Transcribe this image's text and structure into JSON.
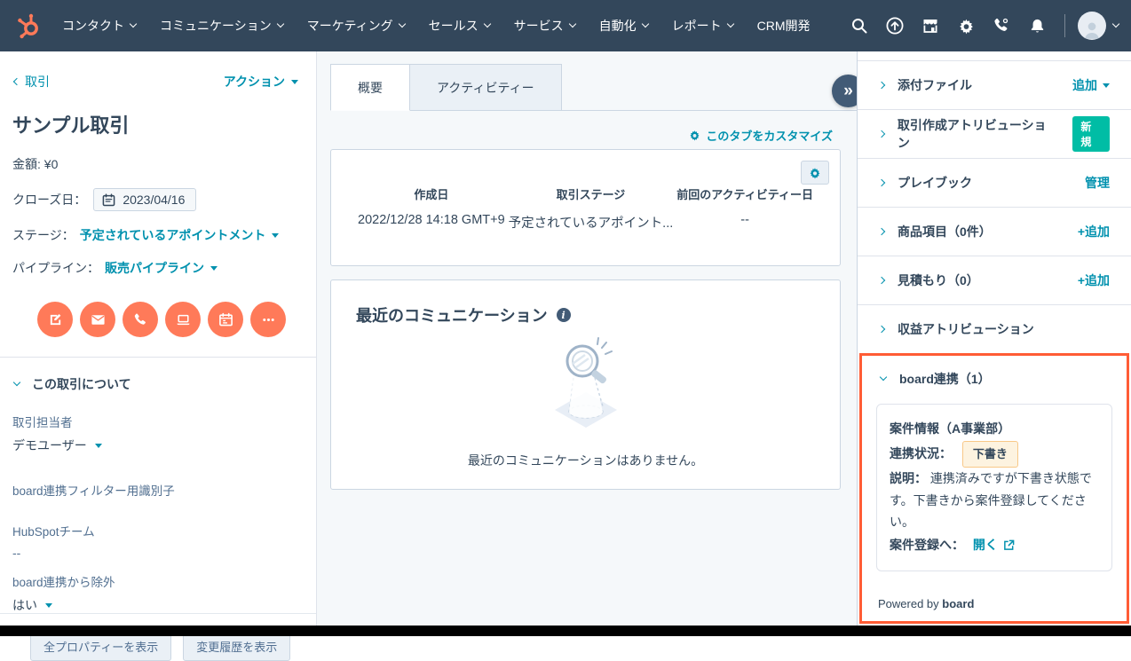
{
  "colors": {
    "navbar_bg": "#33475b",
    "accent_orange": "#ff7a59",
    "link_teal": "#0091ae",
    "text_navy": "#33475b",
    "highlight_border": "#ff5c35",
    "new_badge_bg": "#00bda5",
    "status_badge_bg": "#fdf3e0",
    "status_badge_border": "#f8c888"
  },
  "navbar": {
    "menu": [
      {
        "label": "コンタクト"
      },
      {
        "label": "コミュニケーション"
      },
      {
        "label": "マーケティング"
      },
      {
        "label": "セールス"
      },
      {
        "label": "サービス"
      },
      {
        "label": "自動化"
      },
      {
        "label": "レポート"
      },
      {
        "label": "CRM開発"
      }
    ],
    "icons": [
      "search",
      "upload",
      "marketplace",
      "settings",
      "call",
      "notifications",
      "account"
    ]
  },
  "left_panel": {
    "back_label": "取引",
    "actions_label": "アクション",
    "title": "サンプル取引",
    "amount": "金額: ¥0",
    "close_date_label": "クローズ日：",
    "close_date_value": "2023/04/16",
    "stage_label": "ステージ：",
    "stage_value": "予定されているアポイントメント",
    "pipeline_label": "パイプライン：",
    "pipeline_value": "販売パイプライン",
    "action_icons": [
      "note",
      "email",
      "call",
      "task",
      "meeting",
      "more"
    ],
    "about_title": "この取引について",
    "fields": [
      {
        "label": "取引担当者",
        "value": "デモユーザー"
      },
      {
        "label": "board連携フィルター用識別子",
        "value": ""
      },
      {
        "label": "HubSpotチーム",
        "value": "--"
      },
      {
        "label": "board連携から除外",
        "value": "はい"
      }
    ],
    "show_all_properties": "全プロパティーを表示",
    "show_history": "変更履歴を表示"
  },
  "center": {
    "tabs": [
      {
        "label": "概要"
      },
      {
        "label": "アクティビティー"
      }
    ],
    "active_tab": "概要",
    "collapse_glyph": "»",
    "customize_label": "このタブをカスタマイズ",
    "summary": {
      "columns": [
        {
          "label": "作成日",
          "value": "2022/12/28 14:18 GMT+9"
        },
        {
          "label": "取引ステージ",
          "value": "予定されているアポイント..."
        },
        {
          "label": "前回のアクティビティー日",
          "value": "--"
        }
      ]
    },
    "communications": {
      "title": "最近のコミュニケーション",
      "empty_message": "最近のコミュニケーションはありません。"
    }
  },
  "right_panel": {
    "sections": [
      {
        "title": "添付ファイル",
        "action": "追加"
      },
      {
        "title": "取引作成アトリビューション",
        "badge": "新規"
      },
      {
        "title": "プレイブック",
        "action": "管理"
      },
      {
        "title": "商品項目（0件）",
        "action": "+追加"
      },
      {
        "title": "見積もり（0）",
        "action": "+追加"
      },
      {
        "title": "収益アトリビューション",
        "action": ""
      }
    ],
    "board": {
      "title": "board連携（1）",
      "card": {
        "heading": "案件情報（A事業部）",
        "status_label": "連携状況：",
        "status_value": "下書き",
        "description_label": "説明：",
        "description": "連携済みですが下書き状態です。下書きから案件登録してください。",
        "register_label": "案件登録へ：",
        "register_link": "開く"
      },
      "powered_by": "Powered by",
      "brand": "board"
    }
  }
}
